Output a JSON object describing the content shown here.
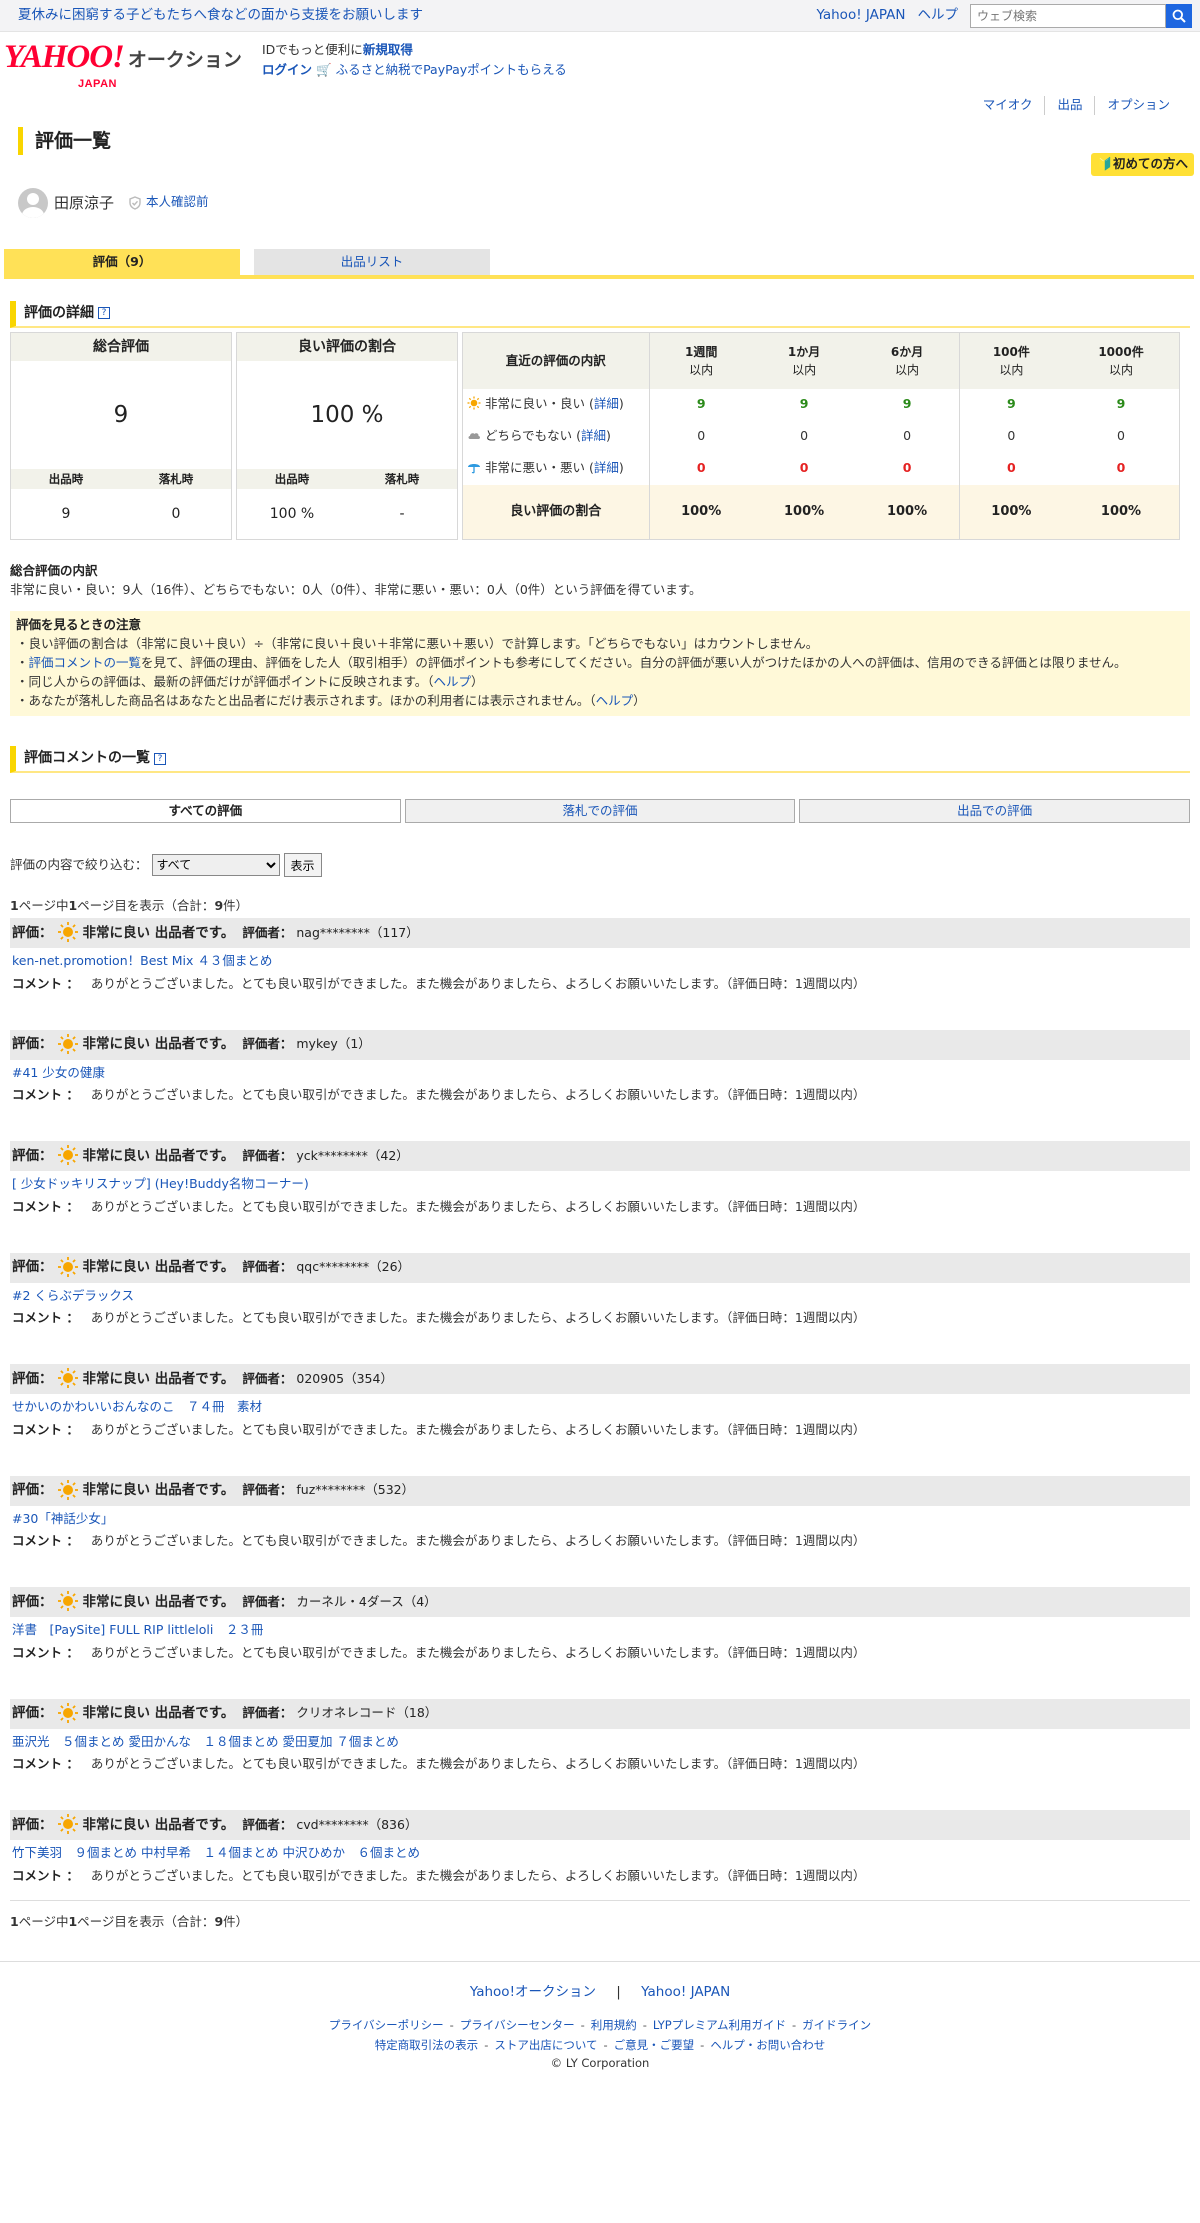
{
  "topbar": {
    "promo": "夏休みに困窮する子どもたちへ食などの面から支援をお願いします",
    "yahoo_japan": "Yahoo! JAPAN",
    "help": "ヘルプ",
    "search_placeholder": "ウェブ検索"
  },
  "header": {
    "logo_main": "YAHOO!",
    "logo_sub": "JAPAN",
    "service": "オークション",
    "id_text": "IDでもっと便利に",
    "new_id": "新規取得",
    "login": "ログイン",
    "furusato": "ふるさと納税でPayPayポイントもらえる"
  },
  "subnav": [
    "マイオク",
    "出品",
    "オプション"
  ],
  "page_title": "評価一覧",
  "beginner": "初めての方へ",
  "user": {
    "name": "田原涼子",
    "verify": "本人確認前"
  },
  "tabs": {
    "ratings": "評価（9）",
    "listings": "出品リスト"
  },
  "detail": {
    "title": "評価の詳細",
    "total": {
      "head": "総合評価",
      "value": "9",
      "sub_heads": [
        "出品時",
        "落札時"
      ],
      "sub_values": [
        "9",
        "0"
      ]
    },
    "good_ratio": {
      "head": "良い評価の割合",
      "value": "100 %",
      "sub_heads": [
        "出品時",
        "落札時"
      ],
      "sub_values": [
        "100 %",
        "-"
      ]
    },
    "recent": {
      "head": "直近の評価の内訳",
      "periods": [
        {
          "top": "1週間",
          "sub": "以内"
        },
        {
          "top": "1か月",
          "sub": "以内"
        },
        {
          "top": "6か月",
          "sub": "以内"
        },
        {
          "top": "100件",
          "sub": "以内"
        },
        {
          "top": "1000件",
          "sub": "以内"
        }
      ],
      "rows": [
        {
          "label": "非常に良い・良い",
          "detail": "詳細",
          "values": [
            "9",
            "9",
            "9",
            "9",
            "9"
          ]
        },
        {
          "label": "どちらでもない",
          "detail": "詳細",
          "values": [
            "0",
            "0",
            "0",
            "0",
            "0"
          ]
        },
        {
          "label": "非常に悪い・悪い",
          "detail": "詳細",
          "values": [
            "0",
            "0",
            "0",
            "0",
            "0"
          ]
        }
      ],
      "ratio_label": "良い評価の割合",
      "ratio_values": [
        "100%",
        "100%",
        "100%",
        "100%",
        "100%"
      ]
    }
  },
  "breakdown": {
    "title": "総合評価の内訳",
    "text": "非常に良い・良い：9人（16件）、どちらでもない：0人（0件）、非常に悪い・悪い：0人（0件）という評価を得ています。"
  },
  "notes": {
    "title": "評価を見るときの注意",
    "line1": "・良い評価の割合は（非常に良い＋良い）÷（非常に良い＋良い＋非常に悪い＋悪い）で計算します。「どちらでもない」はカウントしません。",
    "line2_pre": "・",
    "line2_link": "評価コメントの一覧",
    "line2_post": "を見て、評価の理由、評価をした人（取引相手）の評価ポイントも参考にしてください。自分の評価が悪い人がつけたほかの人への評価は、信用のできる評価とは限りません。",
    "line3_pre": "・同じ人からの評価は、最新の評価だけが評価ポイントに反映されます。（",
    "line3_link": "ヘルプ",
    "line3_post": "）",
    "line4_pre": "・あなたが落札した商品名はあなたと出品者にだけ表示されます。ほかの利用者には表示されません。（",
    "line4_link": "ヘルプ",
    "line4_post": "）"
  },
  "comments": {
    "title": "評価コメントの一覧",
    "filters": [
      "すべての評価",
      "落札での評価",
      "出品での評価"
    ],
    "narrow_label": "評価の内容で絞り込む：",
    "narrow_value": "すべて",
    "show": "表示",
    "page_info": {
      "a": "1",
      "b": "ページ中",
      "c": "1",
      "d": "ページ目を表示（合計：",
      "e": "9",
      "f": "件）"
    },
    "label_rating": "評価：",
    "label_rater": "評価者：",
    "label_comment": "コメント",
    "colon": "：",
    "reviews": [
      {
        "rating": "非常に良い 出品者です。",
        "rater": "nag********（117）",
        "item": "ken-net.promotion！Best Mix ４３個まとめ",
        "comment": "ありがとうございました。とても良い取引ができました。また機会がありましたら、よろしくお願いいたします。（評価日時：1週間以内）"
      },
      {
        "rating": "非常に良い 出品者です。",
        "rater": "mykey（1）",
        "item": "#41 少女の健康",
        "comment": "ありがとうございました。とても良い取引ができました。また機会がありましたら、よろしくお願いいたします。（評価日時：1週間以内）"
      },
      {
        "rating": "非常に良い 出品者です。",
        "rater": "yck********（42）",
        "item": "[ 少女ドッキリスナップ] (Hey!Buddy名物コーナー)",
        "comment": "ありがとうございました。とても良い取引ができました。また機会がありましたら、よろしくお願いいたします。（評価日時：1週間以内）"
      },
      {
        "rating": "非常に良い 出品者です。",
        "rater": "qqc********（26）",
        "item": "#2 くらぶデラックス",
        "comment": "ありがとうございました。とても良い取引ができました。また機会がありましたら、よろしくお願いいたします。（評価日時：1週間以内）"
      },
      {
        "rating": "非常に良い 出品者です。",
        "rater": "020905（354）",
        "item": "せかいのかわいいおんなのこ　７４冊　素材",
        "comment": "ありがとうございました。とても良い取引ができました。また機会がありましたら、よろしくお願いいたします。（評価日時：1週間以内）"
      },
      {
        "rating": "非常に良い 出品者です。",
        "rater": "fuz********（532）",
        "item": "#30「神話少女」",
        "comment": "ありがとうございました。とても良い取引ができました。また機会がありましたら、よろしくお願いいたします。（評価日時：1週間以内）"
      },
      {
        "rating": "非常に良い 出品者です。",
        "rater": "カーネル・4ダース（4）",
        "item": "洋書　[PaySite] FULL RIP littleloli　２３冊",
        "comment": "ありがとうございました。とても良い取引ができました。また機会がありましたら、よろしくお願いいたします。（評価日時：1週間以内）"
      },
      {
        "rating": "非常に良い 出品者です。",
        "rater": "クリオネレコード（18）",
        "item": "亜沢光　５個まとめ 愛田かんな　１８個まとめ 愛田夏加 ７個まとめ",
        "comment": "ありがとうございました。とても良い取引ができました。また機会がありましたら、よろしくお願いいたします。（評価日時：1週間以内）"
      },
      {
        "rating": "非常に良い 出品者です。",
        "rater": "cvd********（836）",
        "item": "竹下美羽　９個まとめ 中村早希　１４個まとめ 中沢ひめか　６個まとめ",
        "comment": "ありがとうございました。とても良い取引ができました。また機会がありましたら、よろしくお願いいたします。（評価日時：1週間以内）"
      }
    ]
  },
  "footer": {
    "main_links": [
      "Yahoo!オークション",
      "Yahoo! JAPAN"
    ],
    "main_sep": "|",
    "links_row1": [
      "プライバシーポリシー",
      "プライバシーセンター",
      "利用規約",
      "LYPプレミアム利用ガイド",
      "ガイドライン"
    ],
    "links_row2": [
      "特定商取引法の表示",
      "ストア出店について",
      "ご意見・ご要望",
      "ヘルプ・お問い合わせ"
    ],
    "link_sep": "-",
    "copyright": "© LY Corporation"
  },
  "colors": {
    "accent": "#ffe157",
    "link": "#1a56b8",
    "good": "#2a8a19",
    "bad": "#e52222",
    "brand": "#ff0033"
  },
  "icons": [
    "search-icon",
    "shield-check-icon",
    "beginner-mark-icon",
    "sun-icon",
    "cloud-icon",
    "umbrella-icon",
    "help-icon",
    "cart-icon",
    "avatar-icon"
  ]
}
